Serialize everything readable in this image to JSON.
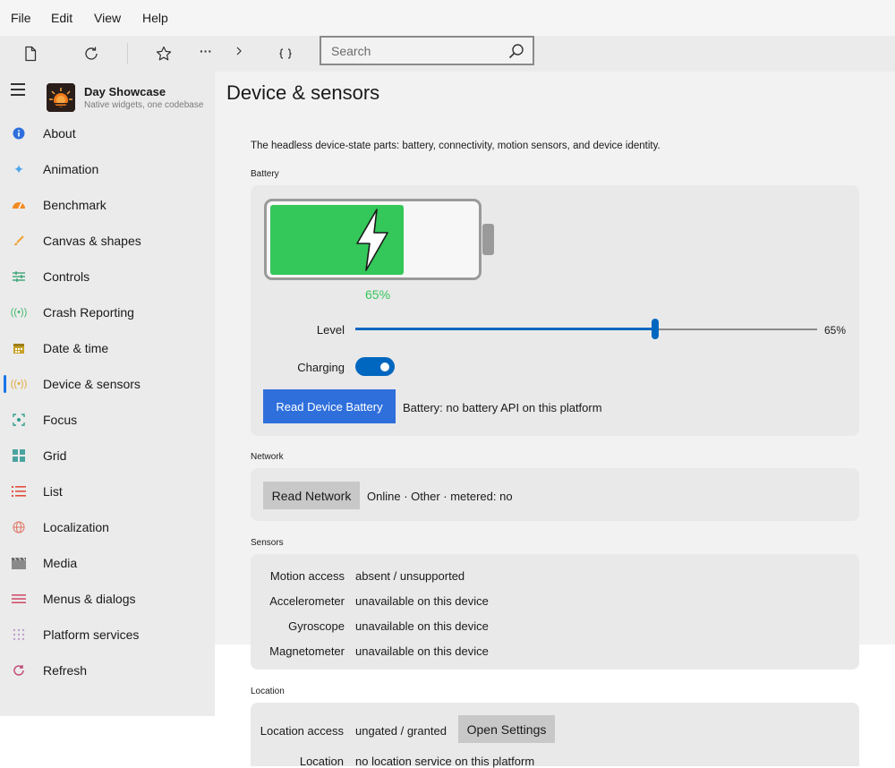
{
  "menubar": {
    "items": [
      "File",
      "Edit",
      "View",
      "Help"
    ]
  },
  "toolbar": {
    "icons": [
      "new-page-icon",
      "refresh-icon",
      "star-icon",
      "more-icon",
      "chevron-right-icon",
      "code-braces-icon"
    ],
    "more_label": "···",
    "search_placeholder": "Search"
  },
  "sidebar": {
    "app_name": "Day Showcase",
    "app_subtitle": "Native widgets, one codebase",
    "selected": "Device & sensors",
    "items": [
      {
        "label": "About",
        "icon": "info-icon",
        "color": "#2e6fdc"
      },
      {
        "label": "Animation",
        "icon": "sparkle-icon",
        "color": "#4aa3e8"
      },
      {
        "label": "Benchmark",
        "icon": "gauge-icon",
        "color": "#f08a24"
      },
      {
        "label": "Canvas & shapes",
        "icon": "brush-icon",
        "color": "#f0a030"
      },
      {
        "label": "Controls",
        "icon": "sliders-icon",
        "color": "#2f9e6f"
      },
      {
        "label": "Crash Reporting",
        "icon": "broadcast-icon",
        "color": "#3fb86b"
      },
      {
        "label": "Date & time",
        "icon": "calendar-icon",
        "color": "#c9a227"
      },
      {
        "label": "Device & sensors",
        "icon": "sensor-icon",
        "color": "#e0a93a"
      },
      {
        "label": "Focus",
        "icon": "focus-icon",
        "color": "#2f9e8f"
      },
      {
        "label": "Grid",
        "icon": "grid-icon",
        "color": "#4aa3a0"
      },
      {
        "label": "List",
        "icon": "list-icon",
        "color": "#e0503a"
      },
      {
        "label": "Localization",
        "icon": "globe-icon",
        "color": "#e07a6a"
      },
      {
        "label": "Media",
        "icon": "clapper-icon",
        "color": "#8a8a8a"
      },
      {
        "label": "Menus & dialogs",
        "icon": "menu-icon",
        "color": "#d0506a"
      },
      {
        "label": "Platform services",
        "icon": "dots-grid-icon",
        "color": "#c0a0d0"
      },
      {
        "label": "Refresh",
        "icon": "refresh-icon",
        "color": "#c04070"
      }
    ]
  },
  "main": {
    "title": "Device & sensors",
    "description": "The headless device-state parts: battery, connectivity, motion sensors, and device identity.",
    "battery": {
      "section_label": "Battery",
      "level_percent": 65,
      "percent_text": "65%",
      "level_label": "Level",
      "level_value_text": "65%",
      "charging_label": "Charging",
      "charging_on": true,
      "read_button": "Read Device Battery",
      "status": "Battery: no battery API on this platform"
    },
    "network": {
      "section_label": "Network",
      "read_button": "Read Network",
      "status": "Online · Other · metered: no"
    },
    "sensors": {
      "section_label": "Sensors",
      "rows": [
        {
          "label": "Motion access",
          "value": "absent / unsupported"
        },
        {
          "label": "Accelerometer",
          "value": "unavailable on this device"
        },
        {
          "label": "Gyroscope",
          "value": "unavailable on this device"
        },
        {
          "label": "Magnetometer",
          "value": "unavailable on this device"
        }
      ]
    },
    "location": {
      "section_label": "Location",
      "access_label": "Location access",
      "access_value": "ungated / granted",
      "settings_button": "Open Settings",
      "location_label": "Location",
      "location_value": "no location service on this platform"
    }
  },
  "colors": {
    "accent": "#0067c0",
    "button_blue": "#2e6fdc",
    "battery_green": "#34c759"
  }
}
